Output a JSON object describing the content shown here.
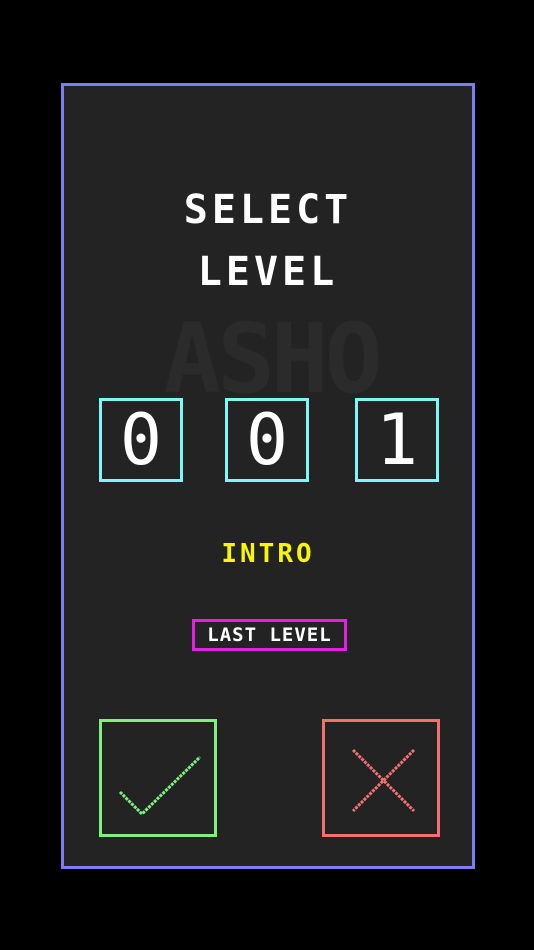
{
  "screen": {
    "title_line_1": "SELECT",
    "title_line_2": "LEVEL",
    "watermark_text": "ASHO"
  },
  "level_selector": {
    "digits": [
      "0",
      "0",
      "1"
    ],
    "level_name": "INTRO"
  },
  "last_level_button": {
    "label": "LAST LEVEL"
  },
  "actions": {
    "confirm_icon": "checkmark-icon",
    "cancel_icon": "x-icon"
  },
  "colors": {
    "background": "#000000",
    "panel": "#232323",
    "panel_border": "#7c7cf5",
    "digit_border": "#7ef7f7",
    "level_name": "#f7f700",
    "last_level_border": "#e61ee6",
    "confirm": "#7ef07e",
    "cancel": "#f57070"
  }
}
